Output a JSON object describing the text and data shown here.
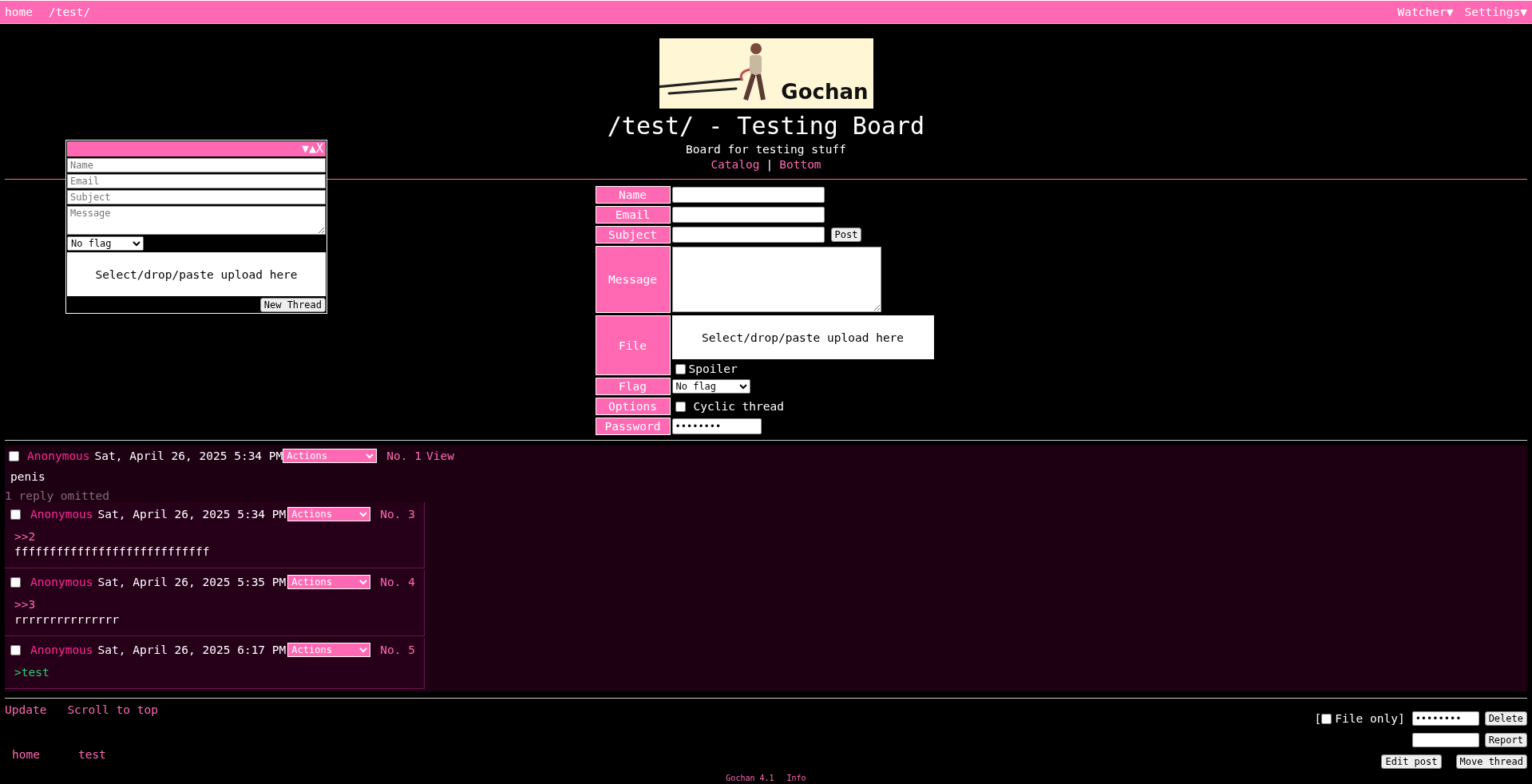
{
  "top_nav": {
    "links": [
      "home",
      "/test/"
    ],
    "menus": [
      "Watcher▼",
      "Settings▼"
    ]
  },
  "header": {
    "banner_text": "Gochan",
    "title": "/test/ - Testing Board",
    "subtitle": "Board for testing stuff",
    "links": [
      "Catalog",
      "Bottom"
    ],
    "separator": "|"
  },
  "quick_reply": {
    "controls": [
      "▼",
      "▲",
      "X"
    ],
    "placeholders": [
      "Name",
      "Email",
      "Subject"
    ],
    "message_placeholder": "Message",
    "flag": "No flag",
    "upload": "Select/drop/paste upload here",
    "submit": "New Thread"
  },
  "post_form": {
    "rows": [
      {
        "label": "Name",
        "kind": "text"
      },
      {
        "label": "Email",
        "kind": "text"
      },
      {
        "label": "Subject",
        "kind": "text",
        "button": "Post"
      },
      {
        "label": "Message",
        "kind": "textarea"
      },
      {
        "label": "File",
        "kind": "file",
        "upload": "Select/drop/paste upload here",
        "option": "Spoiler",
        "checked": false
      },
      {
        "label": "Flag",
        "kind": "select",
        "value": "No flag"
      },
      {
        "label": "Options",
        "kind": "checkbox",
        "option": "Cyclic thread",
        "checked": false
      },
      {
        "label": "Password",
        "kind": "password",
        "value": "••••••••"
      }
    ]
  },
  "thread": {
    "op": {
      "checked": false,
      "name": "Anonymous",
      "date": "Sat, April 26, 2025 5:34 PM",
      "actions": "Actions",
      "number": "No. 1",
      "view": "View",
      "body": [
        {
          "kind": "text",
          "text": "penis"
        }
      ]
    },
    "omitted": "1 reply omitted",
    "replies": [
      {
        "checked": false,
        "name": "Anonymous",
        "date": "Sat, April 26, 2025 5:34 PM",
        "actions": "Actions",
        "number": "No. 3",
        "body": [
          {
            "kind": "reference",
            "text": ">>2"
          },
          {
            "kind": "text",
            "text": "ffffffffffffffffffffffffffff"
          }
        ]
      },
      {
        "checked": false,
        "name": "Anonymous",
        "date": "Sat, April 26, 2025 5:35 PM",
        "actions": "Actions",
        "number": "No. 4",
        "body": [
          {
            "kind": "reference",
            "text": ">>3"
          },
          {
            "kind": "text",
            "text": "rrrrrrrrrrrrrrr"
          }
        ]
      },
      {
        "checked": false,
        "name": "Anonymous",
        "date": "Sat, April 26, 2025 6:17 PM",
        "actions": "Actions",
        "number": "No. 5",
        "body": [
          {
            "kind": "greentext",
            "text": ">test"
          }
        ]
      }
    ]
  },
  "bottom": {
    "links": [
      "Update",
      "Scroll to top"
    ],
    "open_bracket": "[",
    "file_only": {
      "label": "File only",
      "checked": false
    },
    "close_bracket": "]",
    "password": "••••••••",
    "buttons": [
      "Delete",
      "Report",
      "Edit post",
      "Move thread"
    ],
    "footer_links": [
      "home",
      "test"
    ],
    "credits": [
      "Gochan 4.1",
      "Info"
    ]
  }
}
